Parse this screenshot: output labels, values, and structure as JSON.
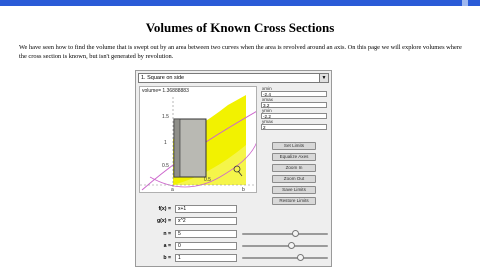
{
  "page": {
    "title": "Volumes of Known Cross Sections",
    "intro": "We have seen how to find the volume that is swept out by an area between two curves when the area is revolved around an axis. On this page we will explore volumes where the cross section is known, but isn't generated by revolution."
  },
  "applet": {
    "dropdown_value": "1. Square on side",
    "volume_text": "volume= 1.36888883",
    "fields": [
      {
        "label": "xmin",
        "value": "-2.4"
      },
      {
        "label": "xmax",
        "value": "3.2"
      },
      {
        "label": "ymin",
        "value": "-2.2"
      },
      {
        "label": "ymax",
        "value": "2"
      }
    ],
    "buttons": [
      "Set Limits",
      "Equalize Axes",
      "Zoom In",
      "Zoom Out",
      "Save Limits",
      "Restore Limits"
    ],
    "functions": [
      {
        "label": "f(x) =",
        "value": "x+1"
      },
      {
        "label": "g(x) =",
        "value": "x^2"
      }
    ],
    "params": [
      {
        "label": "n =",
        "value": "5",
        "level": 0.62
      },
      {
        "label": "a =",
        "value": "0",
        "level": 0.58
      },
      {
        "label": "b =",
        "value": "1",
        "level": 0.68
      }
    ],
    "axis": {
      "y_ticks": [
        "1.5",
        "1",
        "0.5"
      ],
      "x_ticks": [
        "a",
        "0.5",
        "b"
      ]
    },
    "colors": {
      "region": "#f2f200",
      "curve_f": "#cc66cc",
      "slab": "#b9b9b3",
      "edge": "#333333"
    }
  }
}
